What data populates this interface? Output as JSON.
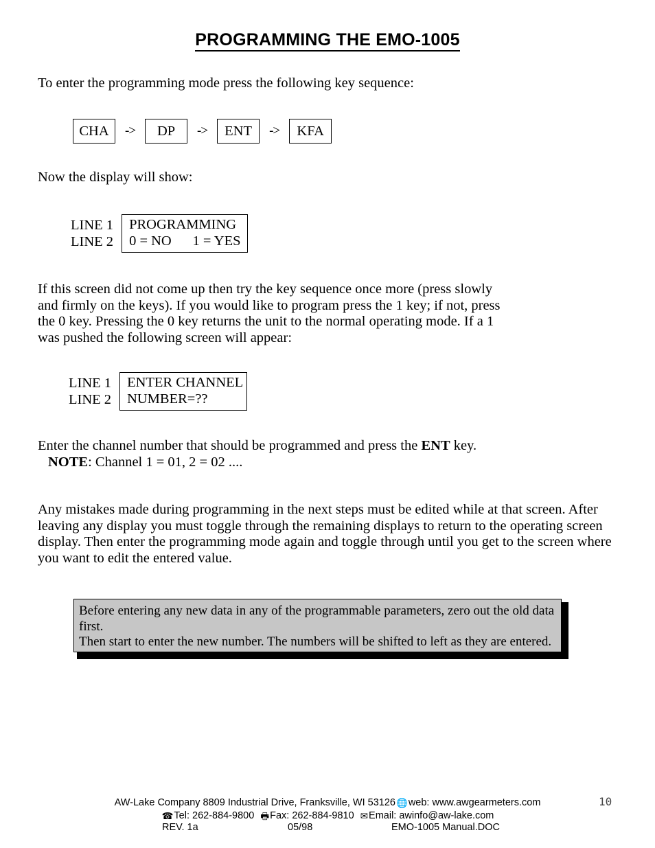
{
  "document": {
    "title": "PROGRAMMING THE EMO-1005",
    "page_number": "10"
  },
  "body": {
    "intro": "To enter the programming mode press the following key sequence:",
    "display_prompt": "Now the display will show:",
    "retry_paragraph": "If this screen did not come up then try the key sequence once more (press slowly and firmly on the keys). If you would like to program press the 1 key; if not, press the 0 key. Pressing the 0 key returns the unit to the normal operating mode. If a 1 was pushed the following screen will appear:",
    "enter_channel_prefix": "Enter the channel number that should be programmed and press the ",
    "enter_channel_bold": "ENT",
    "enter_channel_suffix": " key.",
    "note_label": "NOTE",
    "note_text": ": Channel 1 = 01, 2 = 02 ....",
    "mistakes_paragraph": "Any mistakes made during programming in the next steps must be edited while at that screen. After leaving any display you must toggle through the remaining displays to return to the operating screen display. Then enter the programming mode again and toggle through until you get to the screen where you want to edit the entered value."
  },
  "key_sequence": {
    "arrow": "->",
    "keys": [
      {
        "label": "CHA"
      },
      {
        "label": "DP"
      },
      {
        "label": "ENT"
      },
      {
        "label": "KFA"
      }
    ]
  },
  "displays": [
    {
      "label_line1": "LINE 1",
      "label_line2": "LINE 2",
      "screen_line1": "PROGRAMMING",
      "screen_line2": "0 = NO      1 = YES"
    },
    {
      "label_line1": "LINE 1",
      "label_line2": "LINE 2",
      "screen_line1": "ENTER CHANNEL",
      "screen_line2": "NUMBER=??"
    }
  ],
  "callout": {
    "line1": "Before entering any new data in any of the programmable parameters, zero out the old data first.",
    "line2": "Then start to enter the new number. The numbers will be shifted to left as they are entered.",
    "background_color": "#c6c6c6",
    "border_color": "#000000"
  },
  "footer": {
    "company_line": "AW-Lake Company 8809 Industrial Drive, Franksville, WI 53126",
    "globe_icon": "ⓕ",
    "web_text": "web: www.awgearmeters.com",
    "phone_icon": "☎",
    "tel_text": "Tel:  262-884-9800",
    "fax_icon": "Ὓ6",
    "fax_text": "Fax:  262-884-9810",
    "email_icon": "✉",
    "email_text": "Email: awinfo@aw-lake.com",
    "revision": "REV. 1a",
    "date": "05/98",
    "filename": "EMO-1005 Manual.DOC"
  }
}
